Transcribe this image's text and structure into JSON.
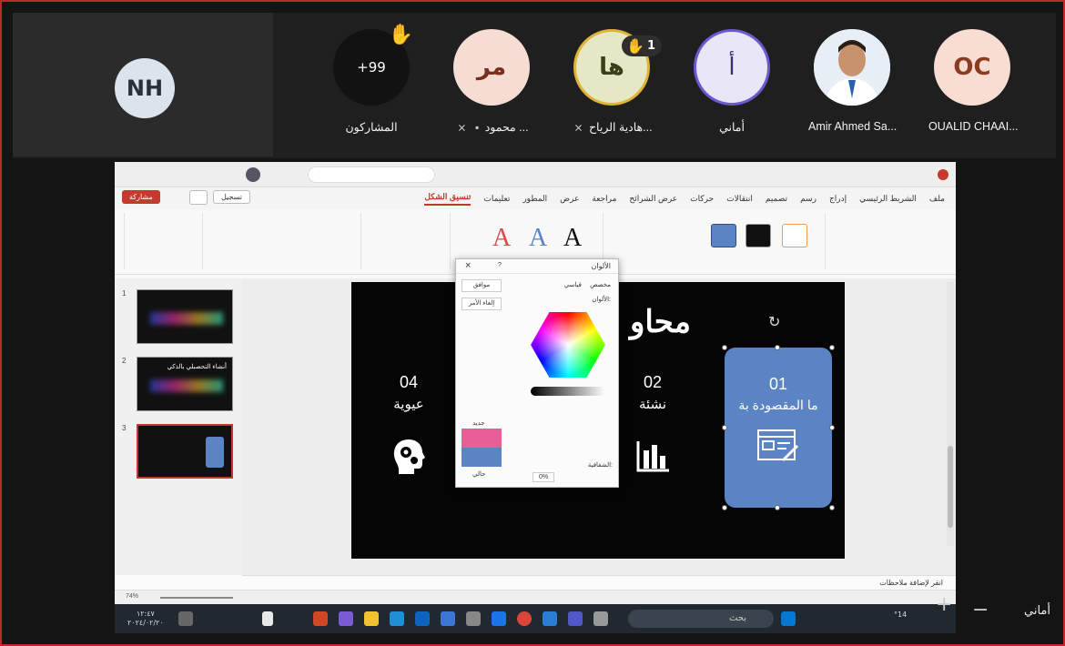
{
  "participants": {
    "host_initials": "NH",
    "tiles": [
      {
        "initials": "+99",
        "name": "المشاركون",
        "bg": "#121212",
        "fg": "#ffffff",
        "hand": true
      },
      {
        "initials": "مر",
        "name": "محمود ...",
        "bg": "#f6ddd4",
        "fg": "#7a2e1e",
        "hand": false
      },
      {
        "initials": "ها",
        "name": "هادية الرياح...",
        "bg": "#e4e8c4",
        "fg": "#3a3f1a",
        "hand_count": "1"
      },
      {
        "initials": "أ",
        "name": "أماني",
        "bg": "#e9e6f5",
        "fg": "#3a2f6b",
        "hand": false
      },
      {
        "initials": "",
        "name": "Amir Ahmed Sa...",
        "bg": "#d8e3ee",
        "fg": "#222222",
        "hand": false
      },
      {
        "initials": "OC",
        "name": "OUALID CHAAI...",
        "bg": "#f9dcd2",
        "fg": "#8a3b22",
        "hand": false
      }
    ]
  },
  "powerpoint": {
    "menu_tabs": [
      "ملف",
      "الشريط الرئيسي",
      "إدراج",
      "رسم",
      "تصميم",
      "انتقالات",
      "حركات",
      "عرض الشرائح",
      "مراجعة",
      "عرض",
      "المطور",
      "تعليمات",
      "تنسيق الشكل"
    ],
    "active_tab": "تنسيق الشكل",
    "share_button": "مشاركة",
    "record_button": "تسجيل",
    "ribbon_letters": [
      "A",
      "A",
      "A"
    ],
    "slide_title": "محاو",
    "cards": {
      "c01_num": "01",
      "c01_text": "ما المقصودة بة",
      "c02_num": "02",
      "c02_text": "نشئة",
      "c04_num": "04",
      "c04_text": "عيوية"
    },
    "thumbnail_numbers": [
      "1",
      "2",
      "3"
    ],
    "thumb2_text": "أنشاء التحصبلي بالذكي",
    "colors_dialog": {
      "title": "الألوان",
      "close": "×",
      "help": "?",
      "tab_standard": "قياسي",
      "tab_custom": "مخصص",
      "label_colors": "الألوان:",
      "label_new": "جديد",
      "label_current": "حالي",
      "label_transparency": "الشفافية:",
      "transparency_value": "0%",
      "ok": "موافق",
      "cancel": "إلغاء الأمر"
    },
    "notes_placeholder": "انقر لإضافة ملاحظات",
    "zoom": "74%"
  },
  "taskbar": {
    "search_placeholder": "بحث",
    "time": "١٢:٤٧",
    "date": "٢٠٢٤/٠٢/٢٠",
    "temperature": "°14"
  },
  "viewer_name": "أماني"
}
